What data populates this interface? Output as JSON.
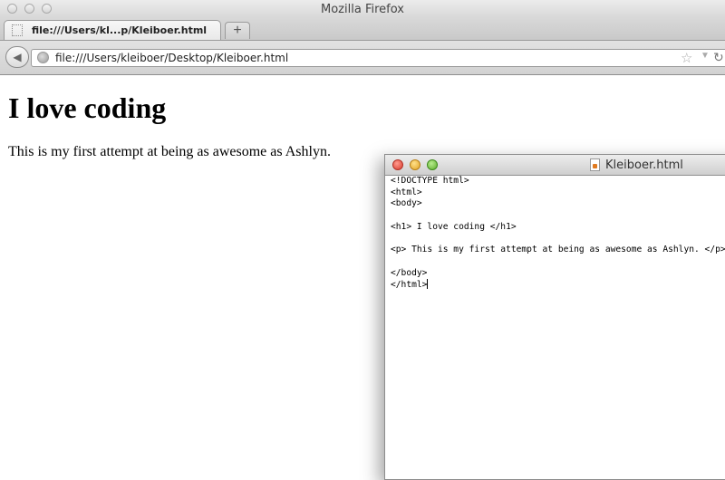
{
  "window": {
    "title": "Mozilla Firefox"
  },
  "tabs": [
    {
      "label": "file:///Users/kl...p/Kleiboer.html"
    }
  ],
  "toolbar": {
    "new_tab": "+",
    "url": "file:///Users/kleiboer/Desktop/Kleiboer.html"
  },
  "page": {
    "heading": "I love coding",
    "paragraph": "This is my first attempt at being as awesome as Ashlyn."
  },
  "editor": {
    "title": "Kleiboer.html",
    "lines": [
      "<!DOCTYPE html>",
      "<html>",
      "<body>",
      "",
      "<h1> I love coding </h1>",
      "",
      "<p> This is my first attempt at being as awesome as Ashlyn. </p>",
      "",
      "</body>",
      "</html>"
    ]
  },
  "icons": {
    "window_controls": "traffic-light-buttons",
    "back": "back-arrow-icon",
    "site": "globe-icon",
    "bookmark": "star-icon",
    "history": "dropdown-icon",
    "reload": "reload-icon",
    "doc": "html-document-icon"
  }
}
